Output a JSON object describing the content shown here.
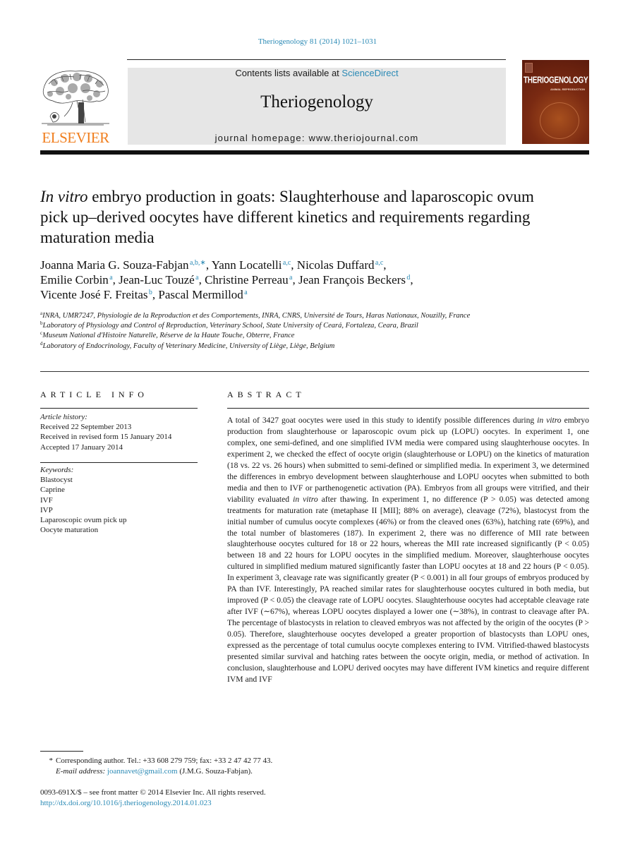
{
  "header": {
    "citation": "Theriogenology 81 (2014) 1021–1031",
    "contents_prefix": "Contents lists available at ",
    "contents_link": "ScienceDirect",
    "journal_name": "Theriogenology",
    "homepage": "journal homepage: www.theriojournal.com",
    "publisher_logo_text": "ELSEVIER",
    "cover_title": "THERIOGENOLOGY",
    "cover_subtitle": "ANIMAL REPRODUCTION",
    "colors": {
      "link": "#2b8ab5",
      "elsevier_orange": "#f07e1e",
      "masthead_bg": "#e6e6e6",
      "cover_bg": "#7a2a12"
    }
  },
  "article": {
    "title_italic": "In vitro",
    "title_rest": " embryo production in goats: Slaughterhouse and laparoscopic ovum pick up–derived oocytes have different kinetics and requirements regarding maturation media",
    "authors": [
      {
        "name": "Joanna Maria G. Souza-Fabjan",
        "sup": "a,b,∗",
        "sep": ", "
      },
      {
        "name": "Yann Locatelli",
        "sup": "a,c",
        "sep": ", "
      },
      {
        "name": "Nicolas Duffard",
        "sup": "a,c",
        "sep": ","
      },
      {
        "name": "Emilie Corbin",
        "sup": "a",
        "sep": ", "
      },
      {
        "name": "Jean-Luc Touzé",
        "sup": "a",
        "sep": ", "
      },
      {
        "name": "Christine Perreau",
        "sup": "a",
        "sep": ", "
      },
      {
        "name": "Jean François Beckers",
        "sup": "d",
        "sep": ","
      },
      {
        "name": "Vicente José F. Freitas",
        "sup": "b",
        "sep": ", "
      },
      {
        "name": "Pascal Mermillod",
        "sup": "a",
        "sep": ""
      }
    ],
    "affiliations": [
      {
        "key": "a",
        "text": "INRA, UMR7247, Physiologie de la Reproduction et des Comportements, INRA, CNRS, Université de Tours, Haras Nationaux, Nouzilly, France"
      },
      {
        "key": "b",
        "text": "Laboratory of Physiology and Control of Reproduction, Veterinary School, State University of Ceará, Fortaleza, Ceara, Brazil"
      },
      {
        "key": "c",
        "text": "Museum National d'Histoire Naturelle, Réserve de la Haute Touche, Obterre, France"
      },
      {
        "key": "d",
        "text": "Laboratory of Endocrinology, Faculty of Veterinary Medicine, University of Liège, Liège, Belgium"
      }
    ]
  },
  "article_info": {
    "heading": "ARTICLE INFO",
    "history_label": "Article history:",
    "history": [
      "Received 22 September 2013",
      "Received in revised form 15 January 2014",
      "Accepted 17 January 2014"
    ],
    "keywords_label": "Keywords:",
    "keywords": [
      "Blastocyst",
      "Caprine",
      "IVF",
      "IVP",
      "Laparoscopic ovum pick up",
      "Oocyte maturation"
    ]
  },
  "abstract": {
    "heading": "ABSTRACT",
    "p1": "A total of 3427 goat oocytes were used in this study to identify possible differences during ",
    "p1_italic": "in vitro",
    "p2": " embryo production from slaughterhouse or laparoscopic ovum pick up (LOPU) oocytes. In experiment 1, one complex, one semi-defined, and one simplified IVM media were compared using slaughterhouse oocytes. In experiment 2, we checked the effect of oocyte origin (slaughterhouse or LOPU) on the kinetics of maturation (18 vs. 22 vs. 26 hours) when submitted to semi-defined or simplified media. In experiment 3, we determined the differences in embryo development between slaughterhouse and LOPU oocytes when submitted to both media and then to IVF or parthenogenetic activation (PA). Embryos from all groups were vitrified, and their viability evaluated ",
    "p2_italic": "in vitro",
    "p3": " after thawing. In experiment 1, no difference (P > 0.05) was detected among treatments for maturation rate (metaphase II [MII]; 88% on average), cleavage (72%), blastocyst from the initial number of cumulus oocyte complexes (46%) or from the cleaved ones (63%), hatching rate (69%), and the total number of blastomeres (187). In experiment 2, there was no difference of MII rate between slaughterhouse oocytes cultured for 18 or 22 hours, whereas the MII rate increased significantly (P < 0.05) between 18 and 22 hours for LOPU oocytes in the simplified medium. Moreover, slaughterhouse oocytes cultured in simplified medium matured significantly faster than LOPU oocytes at 18 and 22 hours (P < 0.05). In experi­ment 3, cleavage rate was significantly greater (P < 0.001) in all four groups of embryos produced by PA than IVF. Interestingly, PA reached similar rates for slaughterhouse oocytes cultured in both media, but improved (P < 0.05) the cleavage rate of LOPU oocytes. Slaughterhouse oocytes had acceptable cleavage rate after IVF (∼67%), whereas LOPU oocytes displayed a lower one (∼38%), in contrast to cleavage after PA. The percentage of blastocysts in relation to cleaved embryos was not affected by the origin of the oocytes (P > 0.05). Therefore, slaughterhouse oocytes developed a greater proportion of blastocysts than LOPU ones, expressed as the percentage of total cumulus oocyte complexes entering to IVM. Vitrified-thawed blastocysts presented similar survival and hatching rates between the oocyte origin, media, or method of activation. In conclusion, slaughterhouse and LOPU derived oocytes may have different IVM kinetics and require different IVM and IVF"
  },
  "footnotes": {
    "star": "*",
    "corresponding": "Corresponding author. Tel.: +33 608 279 759; fax: +33 2 47 42 77 43.",
    "email_label": "E-mail address:",
    "email": "joannavet@gmail.com",
    "email_owner": " (J.M.G. Souza-Fabjan).",
    "copyright": "0093-691X/$ – see front matter © 2014 Elsevier Inc. All rights reserved.",
    "doi": "http://dx.doi.org/10.1016/j.theriogenology.2014.01.023"
  }
}
